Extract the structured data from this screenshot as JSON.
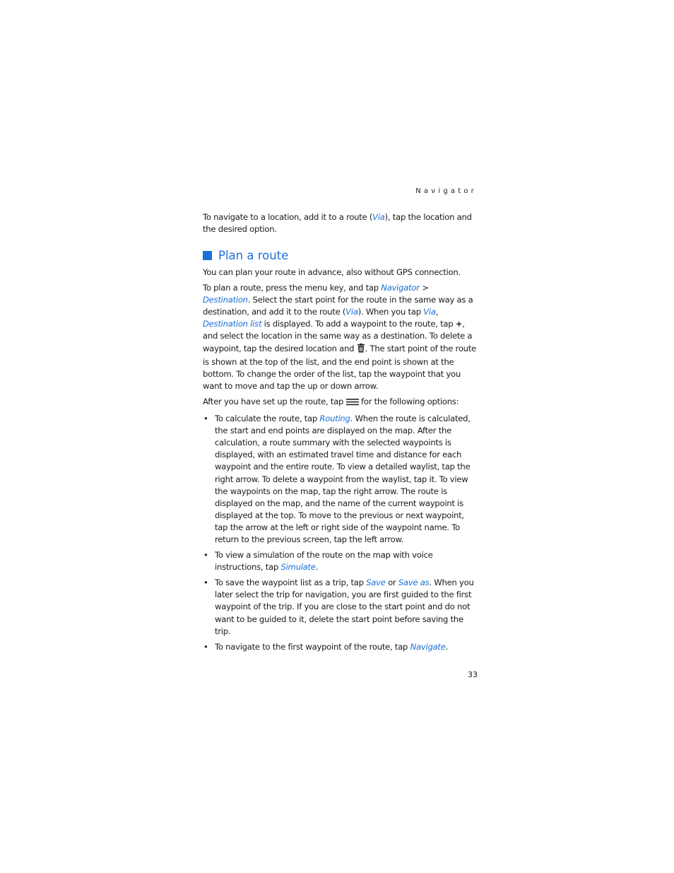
{
  "header": {
    "running_title": "Navigator"
  },
  "intro": {
    "before": "To navigate to a location, add it to a route (",
    "link": "Via",
    "after": "), tap the location and the desired option."
  },
  "section": {
    "title": "Plan a route",
    "p1": "You can plan your route in advance, also without GPS connection.",
    "p2": {
      "t1": "To plan a route, press the menu key, and tap ",
      "l1": "Navigator",
      "t2": " > ",
      "l2": "Destination",
      "t3": ". Select the start point for the route in the same way as a destination, and add it to the route (",
      "l3": "Via",
      "t4": "). When you tap ",
      "l4": "Via",
      "t5": ", ",
      "l5": "Destination list",
      "t6": " is displayed. To add a waypoint to the route, tap ",
      "plus": "+",
      "t7": ", and select the location in the same way as a destination. To delete a waypoint, tap the desired location and ",
      "t8": ". The start point of the route is shown at the top of the list, and the end point is shown at the bottom. To change the order of the list, tap the waypoint that you want to move and tap the up or down arrow."
    },
    "p3": {
      "t1": "After you have set up the route, tap ",
      "t2": " for the following options:"
    },
    "bullets": [
      {
        "t1": "To calculate the route, tap ",
        "l1": "Routing",
        "t2": ". When the route is calculated, the start and end points are displayed on the map. After the calculation, a route summary with the selected waypoints is displayed, with an estimated travel time and distance for each waypoint and the entire route. To view a detailed waylist, tap the right arrow. To delete a waypoint from the waylist, tap it. To view the waypoints on the map, tap the right arrow. The route is displayed on the map, and the name of the current waypoint is displayed at the top. To move to the previous or next waypoint, tap the arrow at the left or right side of the waypoint name. To return to the previous screen, tap the left arrow."
      },
      {
        "t1": "To view a simulation of the route on the map with voice instructions, tap ",
        "l1": "Simulate",
        "t2": "."
      },
      {
        "t1": "To save the waypoint list as a trip, tap ",
        "l1": "Save",
        "t2": " or ",
        "l2": "Save as",
        "t3": ". When you later select the trip for navigation, you are first guided to the first waypoint of the trip. If you are close to the start point and do not want to be guided to it, delete the start point before saving the trip."
      },
      {
        "t1": "To navigate to the first waypoint of the route, tap ",
        "l1": "Navigate",
        "t2": "."
      }
    ],
    "bullet_glyph": "•"
  },
  "icons": {
    "delete": "trash-icon",
    "options": "menu-icon"
  },
  "colors": {
    "accent": "#1b6fd6"
  },
  "footer": {
    "page_number": "33"
  }
}
